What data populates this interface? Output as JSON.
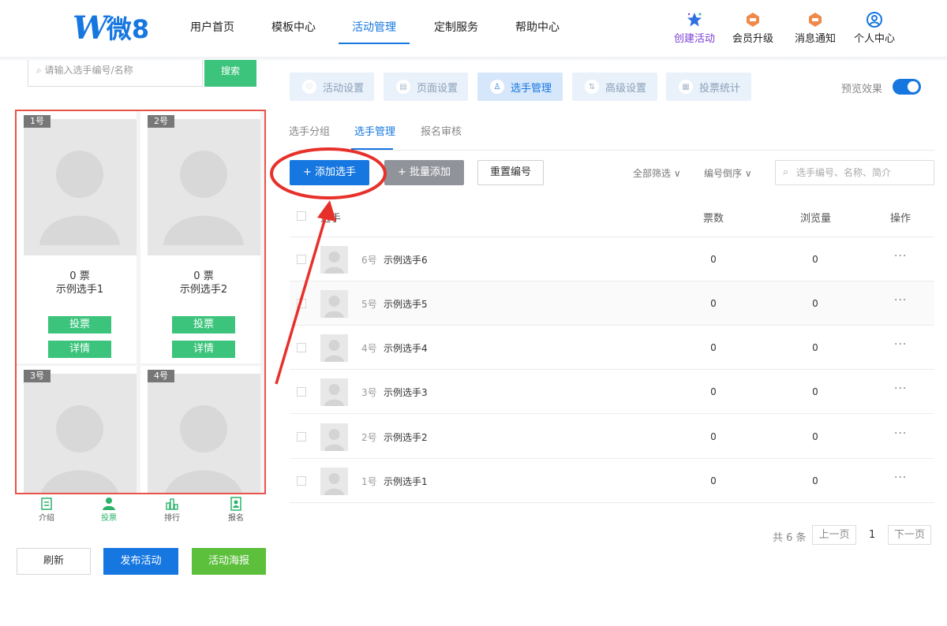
{
  "header": {
    "logo_w": "W",
    "logo_text": "微8",
    "nav": [
      "用户首页",
      "模板中心",
      "活动管理",
      "定制服务",
      "帮助中心"
    ],
    "nav_active": "活动管理",
    "right_nav": [
      {
        "label": "创建活动",
        "icon": "star-icon"
      },
      {
        "label": "会员升级",
        "icon": "badge-icon"
      },
      {
        "label": "消息通知",
        "icon": "badge-icon"
      },
      {
        "label": "个人中心",
        "icon": "user-icon"
      }
    ],
    "accent": "#1677e0"
  },
  "phone": {
    "search_placeholder": "请输入选手编号/名称",
    "search_btn": "搜索",
    "cards": [
      {
        "badge": "1号",
        "votes": "0 票",
        "name": "示例选手1",
        "vote_btn": "投票",
        "detail_btn": "详情"
      },
      {
        "badge": "2号",
        "votes": "0 票",
        "name": "示例选手2",
        "vote_btn": "投票",
        "detail_btn": "详情"
      },
      {
        "badge": "3号"
      },
      {
        "badge": "4号"
      }
    ],
    "tabs": [
      {
        "label": "介绍",
        "icon": "document-icon"
      },
      {
        "label": "投票",
        "icon": "person-icon"
      },
      {
        "label": "排行",
        "icon": "bar-chart-icon"
      },
      {
        "label": "报名",
        "icon": "id-card-icon"
      }
    ],
    "active_tab": "投票",
    "buttons": {
      "refresh": "刷新",
      "publish": "发布活动",
      "poster": "活动海报"
    },
    "green": "#3cc47c"
  },
  "steps": [
    {
      "label": "活动设置",
      "icon": "heart-icon"
    },
    {
      "label": "页面设置",
      "icon": "page-icon"
    },
    {
      "label": "选手管理",
      "icon": "person-icon"
    },
    {
      "label": "高级设置",
      "icon": "settings-icon"
    },
    {
      "label": "投票统计",
      "icon": "stats-icon"
    }
  ],
  "active_step": "选手管理",
  "preview_label": "预览效果",
  "subtabs": [
    "选手分组",
    "选手管理",
    "报名审核"
  ],
  "active_subtab": "选手管理",
  "toolbar": {
    "add": "+ 添加选手",
    "batch": "+ 批量添加",
    "reset": "重置编号",
    "filter_all": "全部筛选 ∨",
    "filter_order": "编号倒序 ∨",
    "search_placeholder": "选手编号、名称、简介"
  },
  "table": {
    "headers": {
      "player": "选手",
      "votes": "票数",
      "views": "浏览量",
      "ops": "操作"
    },
    "rows": [
      {
        "num": "6号",
        "name": "示例选手6",
        "votes": "0",
        "views": "0",
        "ops": "···"
      },
      {
        "num": "5号",
        "name": "示例选手5",
        "votes": "0",
        "views": "0",
        "ops": "···"
      },
      {
        "num": "4号",
        "name": "示例选手4",
        "votes": "0",
        "views": "0",
        "ops": "···"
      },
      {
        "num": "3号",
        "name": "示例选手3",
        "votes": "0",
        "views": "0",
        "ops": "···"
      },
      {
        "num": "2号",
        "name": "示例选手2",
        "votes": "0",
        "views": "0",
        "ops": "···"
      },
      {
        "num": "1号",
        "name": "示例选手1",
        "votes": "0",
        "views": "0",
        "ops": "···"
      }
    ]
  },
  "pagination": {
    "total": "共 6 条",
    "prev": "上一页",
    "current": "1",
    "next": "下一页"
  },
  "annotation_color": "#e8302a"
}
